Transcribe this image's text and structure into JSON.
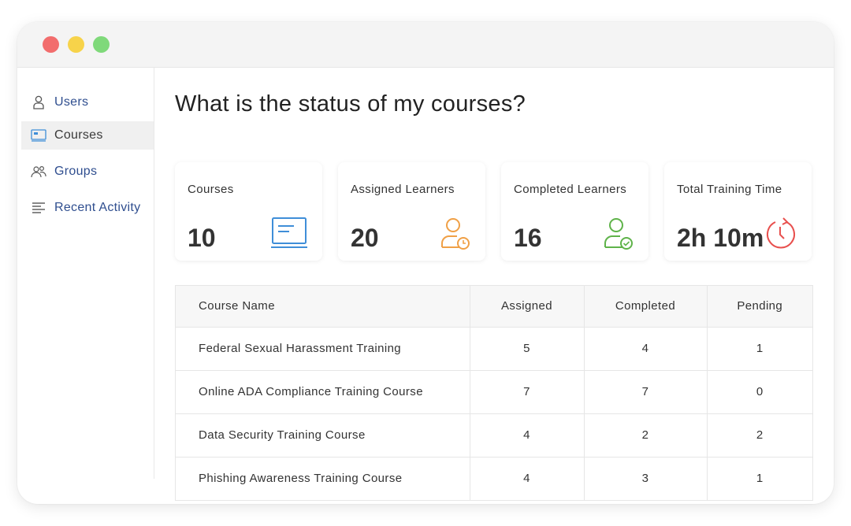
{
  "sidebar": {
    "items": [
      {
        "label": "Users",
        "icon": "user-icon"
      },
      {
        "label": "Courses",
        "icon": "courses-icon",
        "active": true
      },
      {
        "label": "Groups",
        "icon": "groups-icon"
      },
      {
        "label": "Recent Activity",
        "icon": "list-icon"
      }
    ]
  },
  "main": {
    "title": "What is the status of my courses?",
    "stats": [
      {
        "label": "Courses",
        "value": "10",
        "icon": "course-screen-icon",
        "color": "#3f8ed8"
      },
      {
        "label": "Assigned Learners",
        "value": "20",
        "icon": "user-clock-icon",
        "color": "#f0a046"
      },
      {
        "label": "Completed Learners",
        "value": "16",
        "icon": "user-check-icon",
        "color": "#5fb34a"
      },
      {
        "label": "Total Training Time",
        "value": "2h 10m",
        "icon": "timer-icon",
        "color": "#e8504e"
      }
    ],
    "table": {
      "headers": [
        "Course Name",
        "Assigned",
        "Completed",
        "Pending"
      ],
      "rows": [
        [
          "Federal Sexual Harassment Training",
          "5",
          "4",
          "1"
        ],
        [
          "Online ADA Compliance Training Course",
          "7",
          "7",
          "0"
        ],
        [
          "Data Security Training Course",
          "4",
          "2",
          "2"
        ],
        [
          "Phishing Awareness Training Course",
          "4",
          "3",
          "1"
        ]
      ]
    }
  }
}
